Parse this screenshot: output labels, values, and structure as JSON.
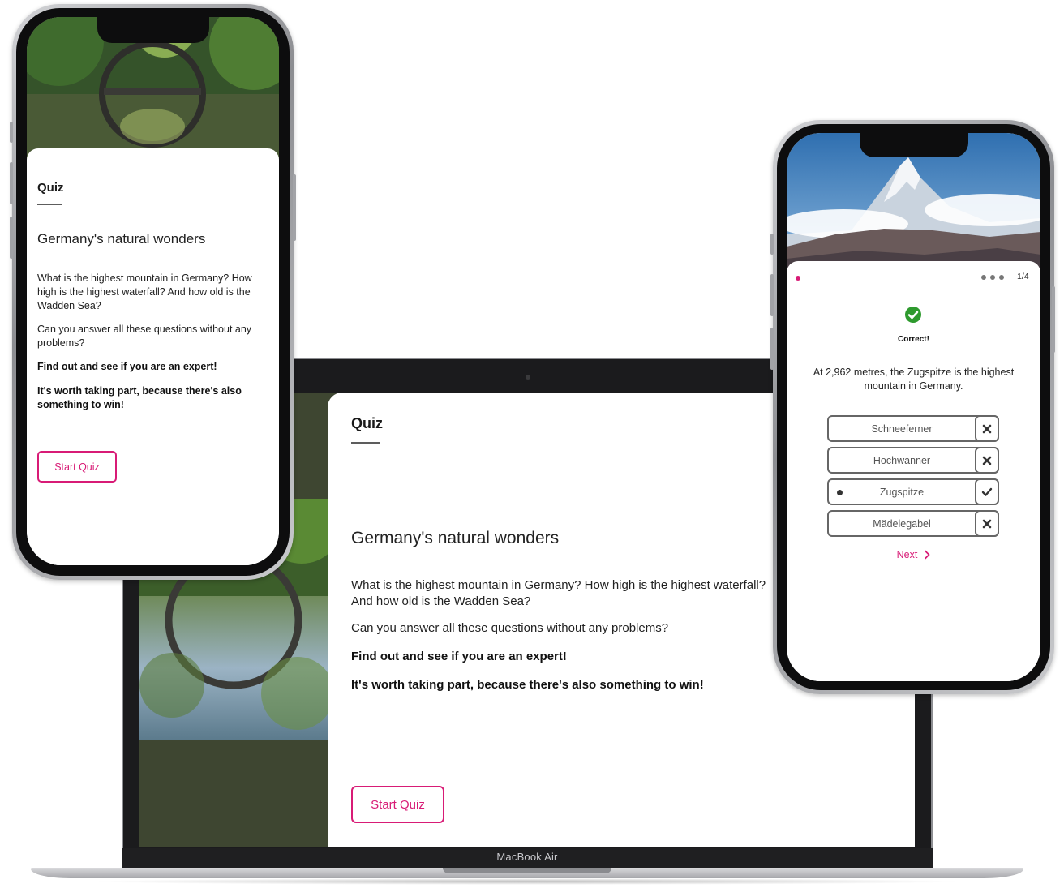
{
  "laptop": {
    "brand": "MacBook Air",
    "card": {
      "label": "Quiz",
      "title": "Germany's natural wonders",
      "intro": "What is the highest mountain in Germany? How high is the highest waterfall? And how old is the Wadden Sea?",
      "question": "Can you answer all these questions without any problems?",
      "call_to_action": "Find out and see if you are an expert!",
      "prize_note": "It's worth taking part, because there's also something to win!",
      "start_button": "Start Quiz"
    }
  },
  "phone_left": {
    "card": {
      "label": "Quiz",
      "title": "Germany's natural wonders",
      "intro": "What is the highest mountain in Germany? How high is the highest waterfall? And how old is the Wadden Sea?",
      "question": "Can you answer all these questions without any problems?",
      "call_to_action": "Find out and see if you are an expert!",
      "prize_note": "It's worth taking part, because there's also something to win!",
      "start_button": "Start Quiz"
    }
  },
  "phone_right": {
    "progress": "1/4",
    "result": "Correct!",
    "explanation": "At 2,962 metres, the Zugspitze is the highest mountain in Germany.",
    "options": [
      {
        "label": "Schneeferner",
        "result": "wrong",
        "selected": false
      },
      {
        "label": "Hochwanner",
        "result": "wrong",
        "selected": false
      },
      {
        "label": "Zugspitze",
        "result": "correct",
        "selected": true
      },
      {
        "label": "Mädelegabel",
        "result": "wrong",
        "selected": false
      }
    ],
    "next_label": "Next"
  },
  "colors": {
    "accent": "#d81b76",
    "success": "#2e9a2e",
    "laptop_backdrop": "#3e4631"
  },
  "icons": {
    "correct": "check-circle-icon",
    "wrong": "x-icon",
    "right": "checkmark-icon",
    "next": "chevron-right-icon"
  }
}
